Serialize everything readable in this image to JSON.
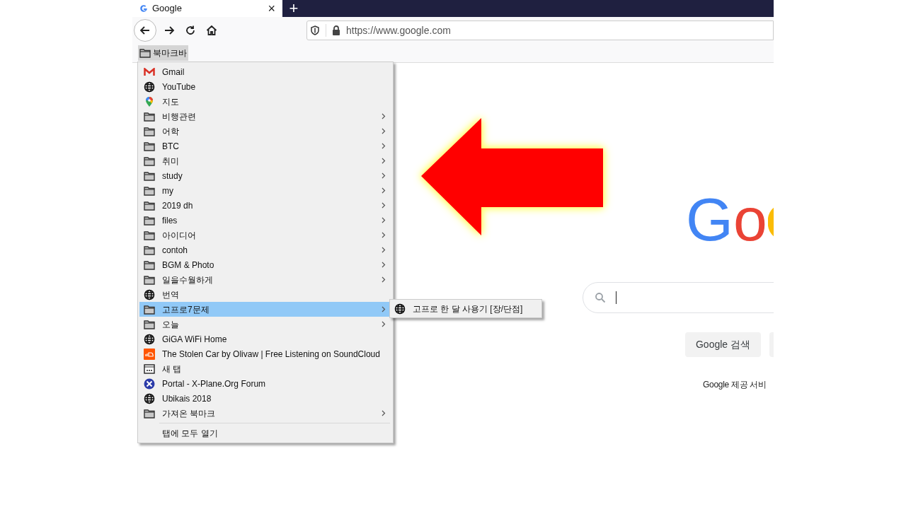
{
  "tab": {
    "title": "Google",
    "close": "×",
    "selected": true
  },
  "new_tab": "+",
  "address_bar": {
    "url": "https://www.google.com"
  },
  "bookmarks_toolbar": {
    "folder": "북마크바",
    "expanded": true
  },
  "bookmark_menu": {
    "items": [
      {
        "label": "Gmail",
        "kind": "gmail",
        "selected": false
      },
      {
        "label": "YouTube",
        "kind": "globe",
        "selected": false
      },
      {
        "label": "지도",
        "kind": "maps",
        "selected": false
      },
      {
        "label": "비행관련",
        "kind": "folder",
        "selected": false
      },
      {
        "label": "어학",
        "kind": "folder",
        "selected": false
      },
      {
        "label": "BTC",
        "kind": "folder",
        "selected": false
      },
      {
        "label": "취미",
        "kind": "folder",
        "selected": false
      },
      {
        "label": "study",
        "kind": "folder",
        "selected": false
      },
      {
        "label": "my",
        "kind": "folder",
        "selected": false
      },
      {
        "label": "2019 dh",
        "kind": "folder",
        "selected": false
      },
      {
        "label": "files",
        "kind": "folder",
        "selected": false
      },
      {
        "label": "아이디어",
        "kind": "folder",
        "selected": false
      },
      {
        "label": "contoh",
        "kind": "folder",
        "selected": false
      },
      {
        "label": "BGM & Photo",
        "kind": "folder",
        "selected": false
      },
      {
        "label": "일을수월하게",
        "kind": "folder",
        "selected": false
      },
      {
        "label": "번역",
        "kind": "globe",
        "selected": false
      },
      {
        "label": "고프로7문제",
        "kind": "folder",
        "selected": true
      },
      {
        "label": "오늘",
        "kind": "folder",
        "selected": false
      },
      {
        "label": "GiGA WiFi Home",
        "kind": "globe",
        "selected": false
      },
      {
        "label": "The Stolen Car by Olivaw | Free Listening on SoundCloud",
        "kind": "soundcloud",
        "selected": false
      },
      {
        "label": "새 탭",
        "kind": "newtab",
        "selected": false
      },
      {
        "label": "Portal - X-Plane.Org Forum",
        "kind": "xplane",
        "selected": false
      },
      {
        "label": "Ubikais 2018",
        "kind": "globe",
        "selected": false
      },
      {
        "label": "가져온 북마크",
        "kind": "folder",
        "selected": false
      }
    ],
    "open_all": "탭에 모두 열기"
  },
  "submenu": {
    "items": [
      {
        "label": "고프로 한 달 사용기 [장/단점]",
        "kind": "globe"
      }
    ]
  },
  "google_page": {
    "logo": "Go",
    "search_button": "Google 검색",
    "services_text": "Google 제공 서비"
  }
}
